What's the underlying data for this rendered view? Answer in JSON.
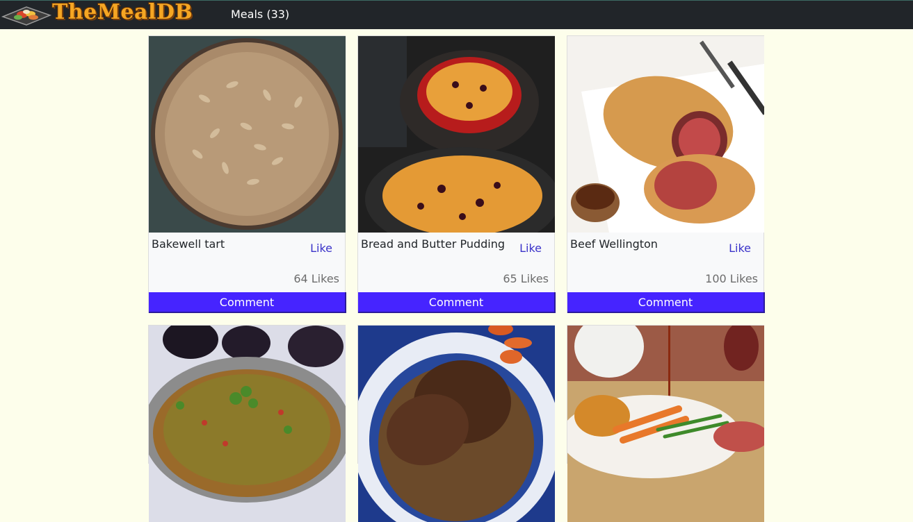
{
  "navbar": {
    "logo_text": "TheMealDB",
    "meals_link": "Meals (33)"
  },
  "colors": {
    "navbar_bg": "#212529",
    "page_bg": "#fdfeeb",
    "comment_button": "#4624ff",
    "like_link": "#3b33c9"
  },
  "meals": [
    {
      "title": "Bakewell tart",
      "like_label": "Like",
      "likes": "64 Likes",
      "comment_label": "Comment",
      "image": "almond-tart-photo"
    },
    {
      "title": "Bread and Butter Pudding",
      "like_label": "Like",
      "likes": "65 Likes",
      "comment_label": "Comment",
      "image": "bread-pudding-photo"
    },
    {
      "title": "Beef Wellington",
      "like_label": "Like",
      "likes": "100 Likes",
      "comment_label": "Comment",
      "image": "beef-wellington-photo"
    },
    {
      "title": "",
      "image": "vegetable-curry-pan-photo"
    },
    {
      "title": "",
      "image": "roast-brisket-platter-photo"
    },
    {
      "title": "",
      "image": "roast-dinner-gravy-photo"
    }
  ]
}
